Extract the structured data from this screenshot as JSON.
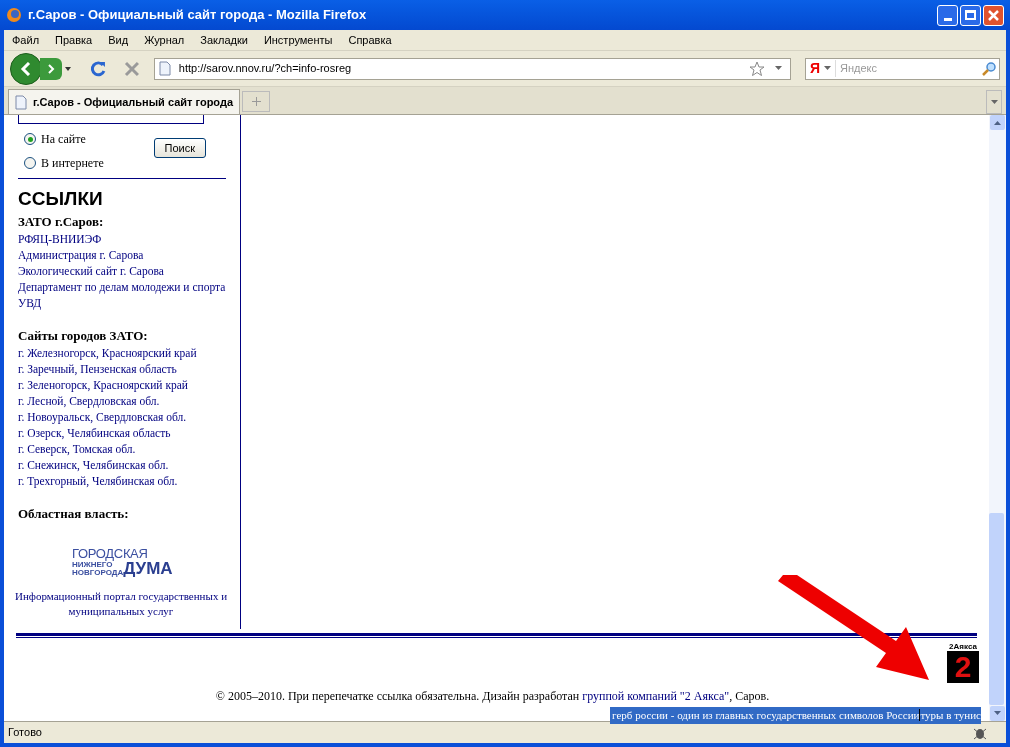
{
  "window": {
    "title": "г.Саров - Официальный сайт города - Mozilla Firefox"
  },
  "menu": [
    "Файл",
    "Правка",
    "Вид",
    "Журнал",
    "Закладки",
    "Инструменты",
    "Справка"
  ],
  "address_bar": {
    "value": "http://sarov.nnov.ru/?ch=info-rosreg"
  },
  "search_bar": {
    "engine": "Я",
    "placeholder": "Яндекс"
  },
  "tabs": [
    {
      "label": "г.Саров - Официальный сайт города",
      "selected": true
    }
  ],
  "site_search": {
    "options": [
      {
        "label": "На сайте",
        "selected": true
      },
      {
        "label": "В интернете",
        "selected": false
      }
    ],
    "button": "Поиск"
  },
  "links_heading": "ССЫЛКИ",
  "link_groups": [
    {
      "title": "ЗАТО г.Саров:",
      "links": [
        "РФЯЦ-ВНИИЭФ",
        "Администрация г. Сарова",
        "Экологический сайт г. Сарова",
        "Департамент по делам молодежи и спорта",
        "УВД"
      ]
    },
    {
      "title": "Сайты городов ЗАТО:",
      "links": [
        "г. Железногорск, Красноярский край",
        "г. Заречный, Пензенская область",
        "г. Зеленогорск, Красноярский край",
        "г. Лесной, Свердловская обл.",
        "г. Новоуральск, Свердловская обл.",
        "г. Озерск, Челябинская область",
        "г. Северск, Томская обл.",
        "г. Снежинск, Челябинская обл.",
        "г. Трехгорный, Челябинская обл."
      ]
    },
    {
      "title": "Областная власть:"
    }
  ],
  "duma_logo": {
    "top": "ГОРОДСКАЯ",
    "small_1": "НИЖНЕГО",
    "small_2": "НОВГОРОДА",
    "big": "ДУМА"
  },
  "portal_link": "Информационный портал государственных и муниципальных услуг",
  "footer": {
    "logo_top": "2Аякса",
    "logo_digit": "2",
    "text_before": "© 2005–2010. При перепечатке ссылка обязательна. Дизайн разработан ",
    "link": "группой компаний \"2 Аякса\"",
    "text_after": ", Саров."
  },
  "selected_links": [
    "герб россии - один из главных государственных символов России",
    "туры в тунис"
  ],
  "status_bar": {
    "text": "Готово"
  }
}
